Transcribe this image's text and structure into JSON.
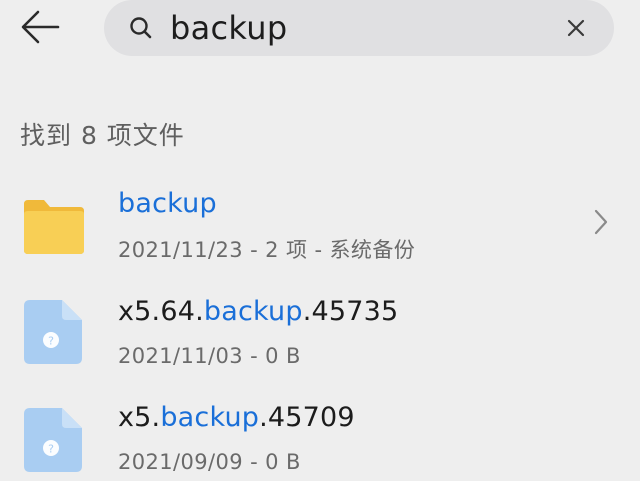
{
  "search": {
    "query": "backup"
  },
  "results": {
    "count_label": "找到 8 项文件",
    "items": [
      {
        "type": "folder",
        "name_parts": [
          "",
          "backup",
          ""
        ],
        "meta": "2021/11/23 - 2 项 - 系统备份"
      },
      {
        "type": "file",
        "name_parts": [
          "x5.64.",
          "backup",
          ".45735"
        ],
        "meta": "2021/11/03 - 0 B"
      },
      {
        "type": "file",
        "name_parts": [
          "x5.",
          "backup",
          ".45709"
        ],
        "meta": "2021/09/09 - 0 B"
      }
    ]
  },
  "colors": {
    "highlight": "#1a6fd8",
    "folder": "#f6c94a",
    "file_icon": "#a9cdf2"
  },
  "icons": {
    "back": "arrow-left-icon",
    "search": "search-icon",
    "clear": "close-icon",
    "folder": "folder-icon",
    "file": "unknown-file-icon",
    "chevron": "chevron-right-icon"
  }
}
